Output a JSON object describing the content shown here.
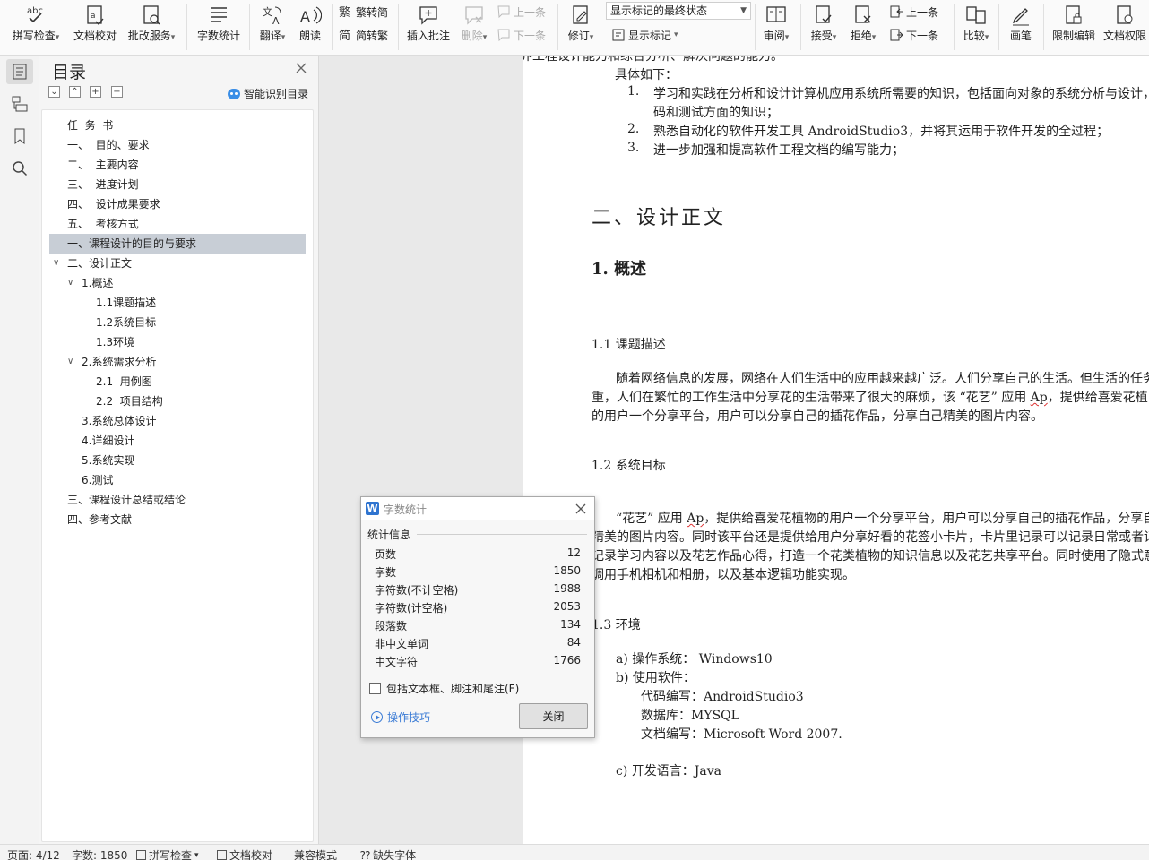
{
  "ribbon": {
    "spell_check": "拼写检查",
    "doc_proof": "文档校对",
    "approve_service": "批改服务",
    "word_count": "字数统计",
    "translate": "翻译",
    "read_aloud": "朗读",
    "trad_simp": "繁转简",
    "simp_trad": "简转繁",
    "insert_comment": "插入批注",
    "delete": "删除",
    "prev_comment": "上一条",
    "next_comment": "下一条",
    "track_changes": "修订",
    "markup_state": "显示标记的最终状态",
    "show_markup": "显示标记",
    "review": "审阅",
    "accept": "接受",
    "reject": "拒绝",
    "prev_change": "上一条",
    "next_change": "下一条",
    "compare": "比较",
    "pen": "画笔",
    "restrict_edit": "限制编辑",
    "doc_permission": "文档权限"
  },
  "toc": {
    "title": "目录",
    "smart_label": "智能识别目录",
    "items": [
      {
        "text": "任  务  书",
        "level": 1,
        "chevron": ""
      },
      {
        "text": "一、  目的、要求",
        "level": 1,
        "chevron": ""
      },
      {
        "text": "二、  主要内容",
        "level": 1,
        "chevron": ""
      },
      {
        "text": "三、  进度计划",
        "level": 1,
        "chevron": ""
      },
      {
        "text": "四、  设计成果要求",
        "level": 1,
        "chevron": ""
      },
      {
        "text": "五、  考核方式",
        "level": 1,
        "chevron": ""
      },
      {
        "text": "一、课程设计的目的与要求",
        "level": 1,
        "chevron": "",
        "selected": true
      },
      {
        "text": "二、设计正文",
        "level": 1,
        "chevron": "∨"
      },
      {
        "text": "1.概述",
        "level": 2,
        "chevron": "∨"
      },
      {
        "text": "1.1课题描述",
        "level": 3,
        "chevron": ""
      },
      {
        "text": "1.2系统目标",
        "level": 3,
        "chevron": ""
      },
      {
        "text": "1.3环境",
        "level": 3,
        "chevron": ""
      },
      {
        "text": "2.系统需求分析",
        "level": 2,
        "chevron": "∨"
      },
      {
        "text": "2.1  用例图",
        "level": 3,
        "chevron": ""
      },
      {
        "text": "2.2  项目结构",
        "level": 3,
        "chevron": ""
      },
      {
        "text": "3.系统总体设计",
        "level": 2,
        "chevron": ""
      },
      {
        "text": "4.详细设计",
        "level": 2,
        "chevron": ""
      },
      {
        "text": "5.系统实现",
        "level": 2,
        "chevron": ""
      },
      {
        "text": "6.测试",
        "level": 2,
        "chevron": ""
      },
      {
        "text": "三、课程设计总结或结论",
        "level": 1,
        "chevron": ""
      },
      {
        "text": "四、参考文献",
        "level": 1,
        "chevron": ""
      }
    ]
  },
  "doc": {
    "line0": "养工程设计能力和综合分析、解决问题的能力。",
    "intro": "具体如下：",
    "list1_num": "1.",
    "list1_a": "学习和实践在分析和设计计算机应用系统所需要的知识，包括面向对象的系统分析与设计，",
    "list1_b": "码和测试方面的知识；",
    "list2_num": "2.",
    "list2": "熟悉自动化的软件开发工具 AndroidStudio3，并将其运用于软件开发的全过程；",
    "list3_num": "3.",
    "list3": "进一步加强和提高软件工程文档的编写能力；",
    "h_section": "二、设计正文",
    "h_overview": "1.  概述",
    "h_1_1": "1.1 课题描述",
    "p1_a": "随着网络信息的发展，网络在人们生活中的应用越来越广泛。人们分享自己的生活。但生活的任务",
    "p1_b_pre": "重，人们在繁忙的工作生活中分享花的生活带来了很大的麻烦，该 “花艺” 应用 ",
    "p1_b_ap": "Ap",
    "p1_b_post": "，提供给喜爱花植",
    "p1_c": "的用户一个分享平台，用户可以分享自己的插花作品，分享自己精美的图片内容。",
    "h_1_2": "1.2 系统目标",
    "p2_a_pre": "“花艺” 应用 ",
    "p2_a_ap": "Ap",
    "p2_a_post": "，提供给喜爱花植物的用户一个分享平台，用户可以分享自己的插花作品，分享自",
    "p2_b": "精美的图片内容。同时该平台还是提供给用户分享好看的花签小卡片，卡片里记录可以记录日常或者记",
    "p2_c": "记录学习内容以及花艺作品心得，打造一个花类植物的知识信息以及花艺共享平台。同时使用了隐式意",
    "p2_d": "调用手机相机和相册，以及基本逻辑功能实现。",
    "h_1_3": "1.3 环境",
    "env_a": "a)  操作系统：   Windows10",
    "env_b": "b)  使用软件：",
    "env_b1": "代码编写：AndroidStudio3",
    "env_b2": "数据库：MYSQL",
    "env_b3": "文档编写：Microsoft Word 2007.",
    "env_c": "c)  开发语言：Java"
  },
  "dialog": {
    "title": "字数统计",
    "section": "统计信息",
    "rows": [
      {
        "label": "页数",
        "value": "12"
      },
      {
        "label": "字数",
        "value": "1850"
      },
      {
        "label": "字符数(不计空格)",
        "value": "1988"
      },
      {
        "label": "字符数(计空格)",
        "value": "2053"
      },
      {
        "label": "段落数",
        "value": "134"
      },
      {
        "label": "非中文单词",
        "value": "84"
      },
      {
        "label": "中文字符",
        "value": "1766"
      }
    ],
    "checkbox_label": "包括文本框、脚注和尾注(F)",
    "tips": "操作技巧",
    "close": "关闭"
  },
  "status": {
    "page": "页面: 4/12",
    "words": "字数: 1850",
    "spell": "拼写检查",
    "proof": "文档校对",
    "compat": "兼容模式",
    "missing_font": "缺失字体"
  }
}
